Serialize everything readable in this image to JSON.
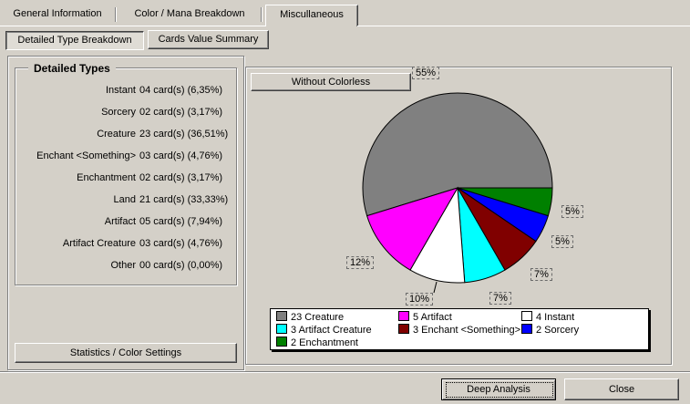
{
  "tabs": [
    "General Information",
    "Color / Mana Breakdown",
    "Miscullaneous"
  ],
  "subtabs": [
    "Detailed Type Breakdown",
    "Cards Value Summary"
  ],
  "types_group_title": "Detailed Types",
  "types": [
    {
      "label": "Instant",
      "value": "04 card(s) (6,35%)"
    },
    {
      "label": "Sorcery",
      "value": "02 card(s) (3,17%)"
    },
    {
      "label": "Creature",
      "value": "23 card(s) (36,51%)"
    },
    {
      "label": "Enchant <Something>",
      "value": "03 card(s) (4,76%)"
    },
    {
      "label": "Enchantment",
      "value": "02 card(s) (3,17%)"
    },
    {
      "label": "Land",
      "value": "21 card(s) (33,33%)"
    },
    {
      "label": "Artifact",
      "value": "05 card(s) (7,94%)"
    },
    {
      "label": "Artifact Creature",
      "value": "03 card(s) (4,76%)"
    },
    {
      "label": "Other",
      "value": "00 card(s) (0,00%)"
    }
  ],
  "stats_button": "Statistics / Color Settings",
  "without_colorless_button": "Without Colorless",
  "chart_data": {
    "type": "pie",
    "slices": [
      {
        "label": "23 Creature",
        "value": 23,
        "percent_label": "55%",
        "color": "#808080"
      },
      {
        "label": "2 Enchantment",
        "value": 2,
        "percent_label": "5%",
        "color": "#008000"
      },
      {
        "label": "2 Sorcery",
        "value": 2,
        "percent_label": "5%",
        "color": "#0000ff"
      },
      {
        "label": "3 Enchant <Something>",
        "value": 3,
        "percent_label": "7%",
        "color": "#800000"
      },
      {
        "label": "3 Artifact Creature",
        "value": 3,
        "percent_label": "7%",
        "color": "#00ffff"
      },
      {
        "label": "4 Instant",
        "value": 4,
        "percent_label": "10%",
        "color": "#ffffff"
      },
      {
        "label": "5 Artifact",
        "value": 5,
        "percent_label": "12%",
        "color": "#ff00ff"
      }
    ],
    "legend_order": [
      "23 Creature",
      "5 Artifact",
      "4 Instant",
      "3 Artifact Creature",
      "3 Enchant <Something>",
      "2 Sorcery",
      "2 Enchantment"
    ],
    "legend_placement": "bottom"
  },
  "footer": {
    "deep_analysis": "Deep Analysis",
    "close": "Close"
  }
}
